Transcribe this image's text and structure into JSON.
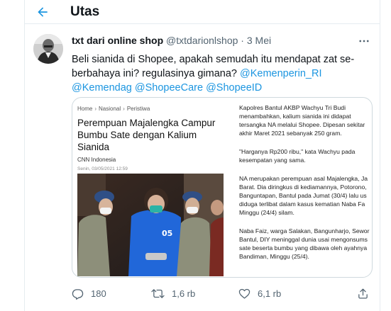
{
  "header": {
    "title": "Utas"
  },
  "tweet": {
    "author_name": "txt dari online shop",
    "author_handle": "@txtdarionlshop",
    "separator": "·",
    "date": "3 Mei",
    "text_plain": "Beli sianida di Shopee, apakah semudah itu mendapat zat se-berbahaya ini? regulasinya gimana?",
    "mentions": [
      "@Kemenperin_RI",
      "@Kemendag",
      "@ShopeeCare",
      "@ShopeeID"
    ]
  },
  "article": {
    "breadcrumb": [
      "Home",
      "Nasional",
      "Peristiwa"
    ],
    "breadcrumb_sep": "›",
    "title": "Perempuan Majalengka Campur Bumbu Sate dengan Kalium Sianida",
    "source": "CNN Indonesia",
    "date": "Senin, 03/05/2021 12:59",
    "right_lines": [
      "Kapolres Bantul AKBP Wachyu Tri Budi",
      "menambahkan, kalium sianida ini didapat",
      "tersangka NA melalui Shopee. Dipesan sekitar",
      "akhir Maret 2021 sebanyak 250 gram.",
      "\"Harganya Rp200 ribu,\" kata Wachyu pada",
      "kesempatan yang sama.",
      "NA merupakan perempuan asal Majalengka, Ja",
      "Barat. Dia diringkus di kediamannya, Potorono,",
      "Banguntapan, Bantul pada Jumat (30/4) lalu us",
      "diduga terlibat dalam kasus kematian Naba Fa",
      "Minggu (24/4) silam.",
      "Naba Faiz, warga Salakan, Bangunharjo, Sewor",
      "Bantul, DIY meninggal dunia usai mengonsums",
      "sate beserta bumbu yang dibawa oleh ayahnya",
      "Bandiman, Minggu (25/4)."
    ]
  },
  "actions": {
    "reply_count": "180",
    "retweet_count": "1,6 rb",
    "like_count": "6,1 rb"
  },
  "colors": {
    "accent": "#1b95e0",
    "secondary_text": "#536471",
    "border": "#e6ecf0"
  },
  "icons": {
    "back": "arrow-left-icon",
    "more": "more-horizontal-icon",
    "reply": "reply-icon",
    "retweet": "retweet-icon",
    "like": "heart-icon",
    "share": "share-icon"
  }
}
